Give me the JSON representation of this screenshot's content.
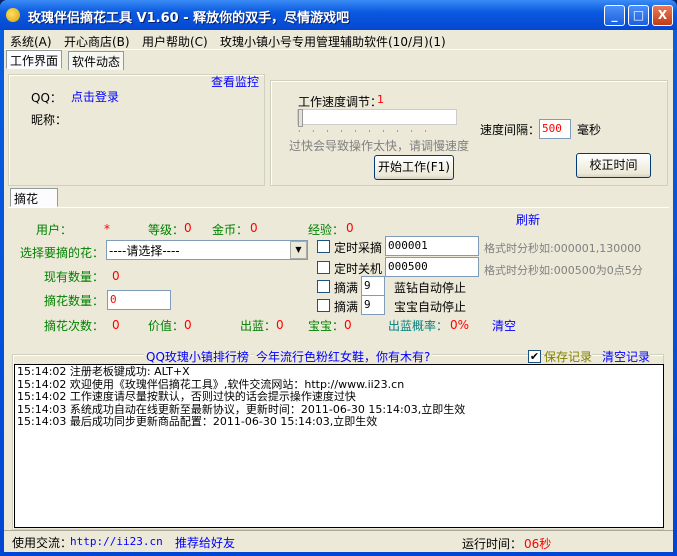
{
  "title": "玫瑰伴侣摘花工具 V1.60 - 释放你的双手，尽情游戏吧",
  "window_buttons": [
    "_",
    "□",
    "X"
  ],
  "menu": [
    "系统(A)",
    "开心商店(B)",
    "用户帮助(C)",
    "玫瑰小镇小号专用管理辅助软件(10/月)(1)"
  ],
  "tabs": [
    "工作界面",
    "软件动态"
  ],
  "login": {
    "qq_label": "QQ：",
    "login_link": "点击登录",
    "nick_label": "昵称：",
    "monitor_link": "查看监控"
  },
  "speed": {
    "label": "工作速度调节：",
    "value": "1",
    "slider_fraction": 0.0,
    "warning": "过快会导致操作太快，请调慢速度",
    "interval_label": "速度间隔：",
    "interval_value": "500",
    "interval_unit": "毫秒",
    "start_button": "开始工作(F1)",
    "calibrate_button": "校正时间"
  },
  "subtab": "摘花",
  "stats": {
    "user_label": "用户：",
    "user_value": "*",
    "level_label": "等级：",
    "level_value": "0",
    "gold_label": "金币：",
    "gold_value": "0",
    "exp_label": "经验：",
    "exp_value": "0",
    "refresh": "刷新",
    "select_label": "选择要摘的花：",
    "select_value": "----请选择----",
    "have_label": "现有数量：",
    "have_value": "0",
    "pick_qty_label": "摘花数量：",
    "pick_qty_value": "0",
    "pick_count_label": "摘花次数：",
    "pick_count_value": "0",
    "worth_label": "价值：",
    "worth_value": "0",
    "blue_label": "出蓝：",
    "blue_value": "0",
    "baby_label": "宝宝：",
    "baby_value": "0",
    "rate_label": "出蓝概率：",
    "rate_value": "0%",
    "clear": "清空"
  },
  "options": {
    "timed_pick_label": "定时采摘",
    "timed_pick_value": "000001",
    "timed_pick_hint": "格式时分秒如:000001,130000",
    "timed_shutdown_label": "定时关机",
    "timed_shutdown_value": "000500",
    "timed_shutdown_hint": "格式时分秒如:000500为0点5分",
    "full_label": "摘满",
    "blue_stop_value": "9",
    "blue_stop_label": "蓝钻自动停止",
    "baby_stop_value": "9",
    "baby_stop_label": "宝宝自动停止"
  },
  "log": {
    "link1": "QQ玫瑰小镇排行榜",
    "link2": "今年流行色粉红女鞋，你有木有?",
    "save_label": "保存记录",
    "save_checked": true,
    "clear_label": "清空记录",
    "lines": [
      "15:14:02 注册老板键成功: ALT+X",
      "15:14:02 欢迎使用《玫瑰伴侣摘花工具》,软件交流网站：http://www.ii23.cn",
      "15:14:02 工作速度请尽量按默认，否则过快的话会提示操作速度过快",
      "15:14:03 系统成功自动在线更新至最新协议，更新时间：2011-06-30 15:14:03,立即生效",
      "15:14:03 最后成功同步更新商品配置：2011-06-30 15:14:03,立即生效"
    ]
  },
  "status": {
    "exchange_label": "使用交流：",
    "exchange_link": "http://ii23.cn",
    "recommend": "推荐给好友",
    "runtime_label": "运行时间：",
    "runtime_value": "06秒"
  }
}
